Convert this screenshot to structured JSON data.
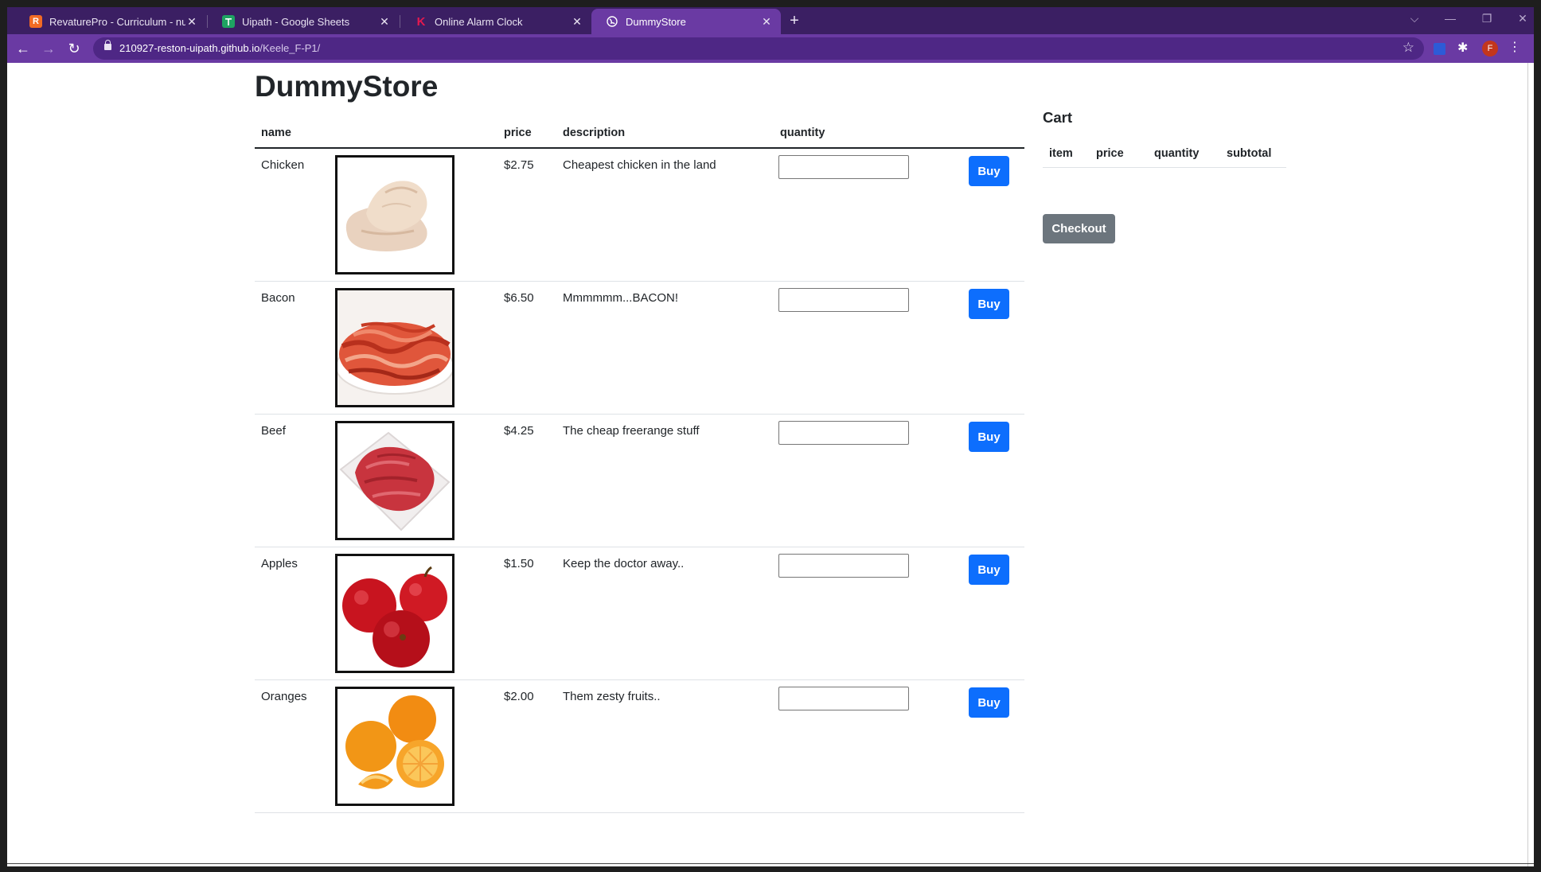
{
  "browser": {
    "tabs": [
      {
        "title": "RevaturePro - Curriculum - null",
        "favicon_letter": "R",
        "favicon_color": "#f26b24"
      },
      {
        "title": "Uipath - Google Sheets",
        "favicon_letter": "",
        "favicon_color": "#1ea362"
      },
      {
        "title": "Online Alarm Clock",
        "favicon_letter": "K",
        "favicon_color": "#e5194f"
      },
      {
        "title": "DummyStore",
        "favicon_letter": "",
        "favicon_color": "#ffffff"
      }
    ],
    "url_host": "210927-reston-uipath.github.io",
    "url_path": "/Keele_F-P1/",
    "profile_initial": "F",
    "theme_color": "#6a3aa3"
  },
  "store": {
    "title": "DummyStore",
    "columns": {
      "name": "name",
      "price": "price",
      "description": "description",
      "quantity": "quantity"
    },
    "buy_label": "Buy",
    "products": [
      {
        "name": "Chicken",
        "price": "$2.75",
        "description": "Cheapest chicken in the land",
        "image": "chicken-breast"
      },
      {
        "name": "Bacon",
        "price": "$6.50",
        "description": "Mmmmmm...BACON!",
        "image": "bacon-plate"
      },
      {
        "name": "Beef",
        "price": "$4.25",
        "description": "The cheap freerange stuff",
        "image": "ground-beef"
      },
      {
        "name": "Apples",
        "price": "$1.50",
        "description": "Keep the doctor away..",
        "image": "red-apples"
      },
      {
        "name": "Oranges",
        "price": "$2.00",
        "description": "Them zesty fruits..",
        "image": "oranges"
      }
    ]
  },
  "cart": {
    "title": "Cart",
    "columns": {
      "item": "item",
      "price": "price",
      "quantity": "quantity",
      "subtotal": "subtotal"
    },
    "checkout_label": "Checkout"
  },
  "colors": {
    "primary": "#0d6efd",
    "secondary": "#6c757d"
  }
}
